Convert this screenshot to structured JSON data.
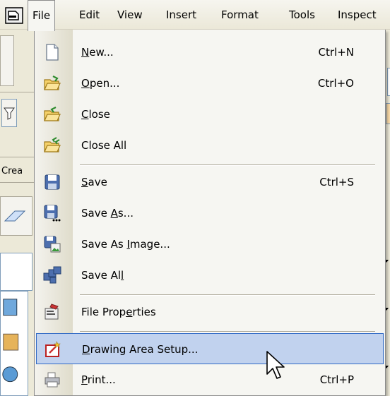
{
  "menubar": {
    "items": [
      "File",
      "Edit",
      "View",
      "Insert",
      "Format",
      "Tools",
      "Inspect"
    ],
    "active": "File",
    "app_icon": "app-icon"
  },
  "background": {
    "toolbar_label": "Crea"
  },
  "file_menu": {
    "items": [
      {
        "pre": "",
        "key": "N",
        "post": "ew...",
        "shortcut": "Ctrl+N",
        "icon": "new-document-icon"
      },
      {
        "pre": "",
        "key": "O",
        "post": "pen...",
        "shortcut": "Ctrl+O",
        "icon": "open-folder-icon"
      },
      {
        "pre": "",
        "key": "C",
        "post": "lose",
        "shortcut": "",
        "icon": "close-folder-icon"
      },
      {
        "pre": "Close All",
        "key": "",
        "post": "",
        "shortcut": "",
        "icon": "close-all-folder-icon"
      },
      {
        "pre": "",
        "key": "S",
        "post": "ave",
        "shortcut": "Ctrl+S",
        "icon": "save-disk-icon"
      },
      {
        "pre": "Save ",
        "key": "A",
        "post": "s...",
        "shortcut": "",
        "icon": "save-as-disk-icon"
      },
      {
        "pre": "Save As ",
        "key": "I",
        "post": "mage...",
        "shortcut": "",
        "icon": "save-as-image-icon"
      },
      {
        "pre": "Save Al",
        "key": "l",
        "post": "",
        "shortcut": "",
        "icon": "save-all-icon"
      },
      {
        "pre": "File Prop",
        "key": "e",
        "post": "rties",
        "shortcut": "",
        "icon": "file-properties-icon"
      },
      {
        "pre": "",
        "key": "D",
        "post": "rawing Area Setup...",
        "shortcut": "",
        "icon": "drawing-area-setup-icon",
        "highlighted": true
      },
      {
        "pre": "",
        "key": "P",
        "post": "rint...",
        "shortcut": "Ctrl+P",
        "icon": "printer-icon"
      }
    ]
  },
  "colors": {
    "menu_bg": "#f6f6f2",
    "highlight_bg": "#c1d2ee",
    "highlight_border": "#316ac5"
  }
}
